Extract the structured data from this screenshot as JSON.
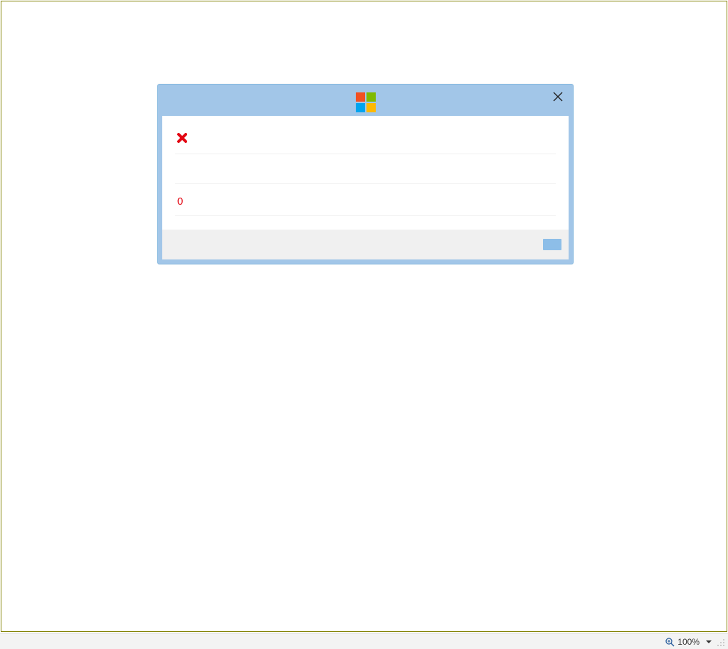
{
  "dialog": {
    "rows": {
      "status_icon": "error",
      "value_text": "0"
    },
    "footer": {
      "ok_label": ""
    }
  },
  "status_bar": {
    "zoom_label": "100%"
  }
}
